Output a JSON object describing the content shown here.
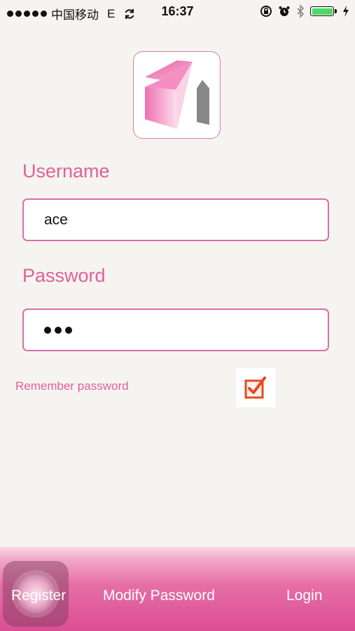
{
  "status_bar": {
    "carrier": "中国移动",
    "network": "E",
    "time": "16:37",
    "icons": [
      "signal-dots-icon",
      "sync-icon",
      "rotation-lock-icon",
      "alarm-icon",
      "bluetooth-icon",
      "battery-icon",
      "charging-icon"
    ]
  },
  "logo": {
    "icon": "house-logo-icon"
  },
  "username": {
    "label": "Username",
    "value": "ace"
  },
  "password": {
    "label": "Password",
    "masked_length": 3
  },
  "remember": {
    "label": "Remember password",
    "checked": true
  },
  "bottom_bar": {
    "register": "Register",
    "modify_password": "Modify Password",
    "login": "Login"
  },
  "colors": {
    "accent": "#e0609a",
    "input_border": "#d770ab",
    "checkbox": "#e8471f",
    "background": "#f5f4f0",
    "battery": "#4cd964"
  }
}
